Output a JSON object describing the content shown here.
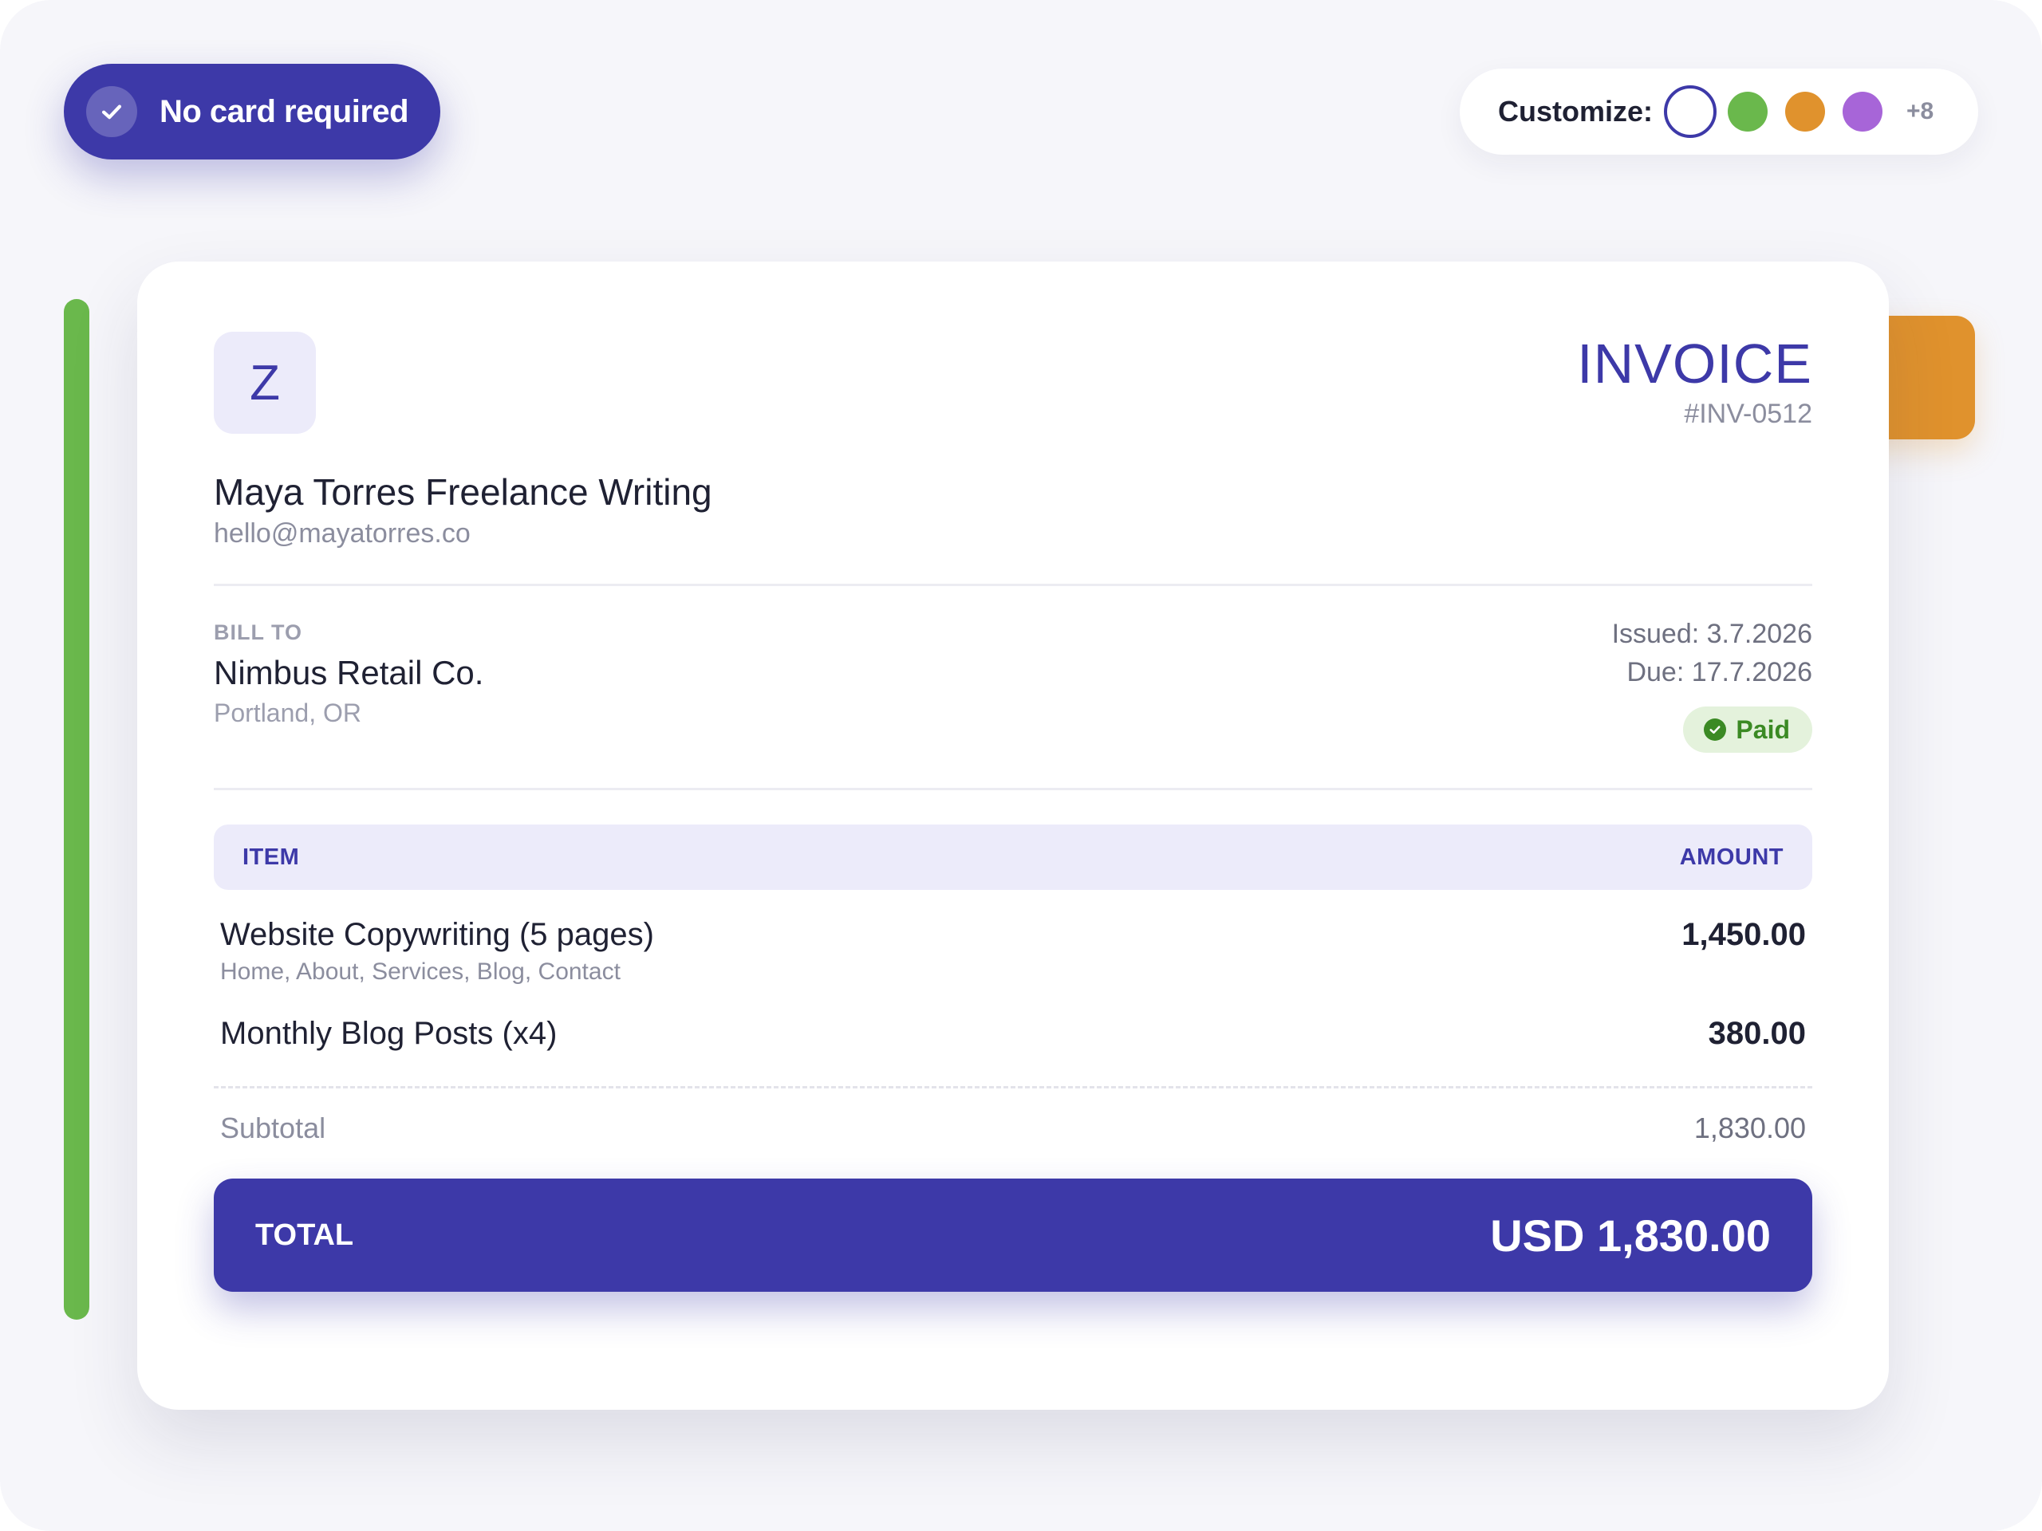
{
  "badge": {
    "label": "No card required"
  },
  "customize": {
    "label": "Customize:",
    "swatches": [
      {
        "name": "indigo",
        "color": "#3d39a8",
        "selected": true
      },
      {
        "name": "green",
        "color": "#6ab84c",
        "selected": false
      },
      {
        "name": "orange",
        "color": "#e0922d",
        "selected": false
      },
      {
        "name": "purple",
        "color": "#a765d8",
        "selected": false
      }
    ],
    "more_label": "+8"
  },
  "invoice": {
    "logo_letter": "Z",
    "business_name": "Maya Torres Freelance Writing",
    "business_email": "hello@mayatorres.co",
    "title": "INVOICE",
    "number": "#INV-0512",
    "bill_to": {
      "label": "BILL TO",
      "name": "Nimbus Retail Co.",
      "location": "Portland, OR"
    },
    "issued": "Issued: 3.7.2026",
    "due": "Due: 17.7.2026",
    "status": "Paid",
    "table": {
      "headers": [
        "ITEM",
        "AMOUNT"
      ],
      "rows": [
        {
          "title": "Website Copywriting (5 pages)",
          "description": "Home, About, Services, Blog, Contact",
          "amount": "1,450.00"
        },
        {
          "title": "Monthly Blog Posts (x4)",
          "description": "",
          "amount": "380.00"
        }
      ]
    },
    "subtotal_label": "Subtotal",
    "subtotal_value": "1,830.00",
    "total_label": "TOTAL",
    "total_value": "USD 1,830.00"
  },
  "colors": {
    "primary": "#3d39a8",
    "accent_green": "#6ab84c",
    "accent_orange": "#e0922d",
    "paid_green": "#3b8a24"
  },
  "icons": {
    "badge": "check-icon",
    "status": "check-circle-icon"
  }
}
